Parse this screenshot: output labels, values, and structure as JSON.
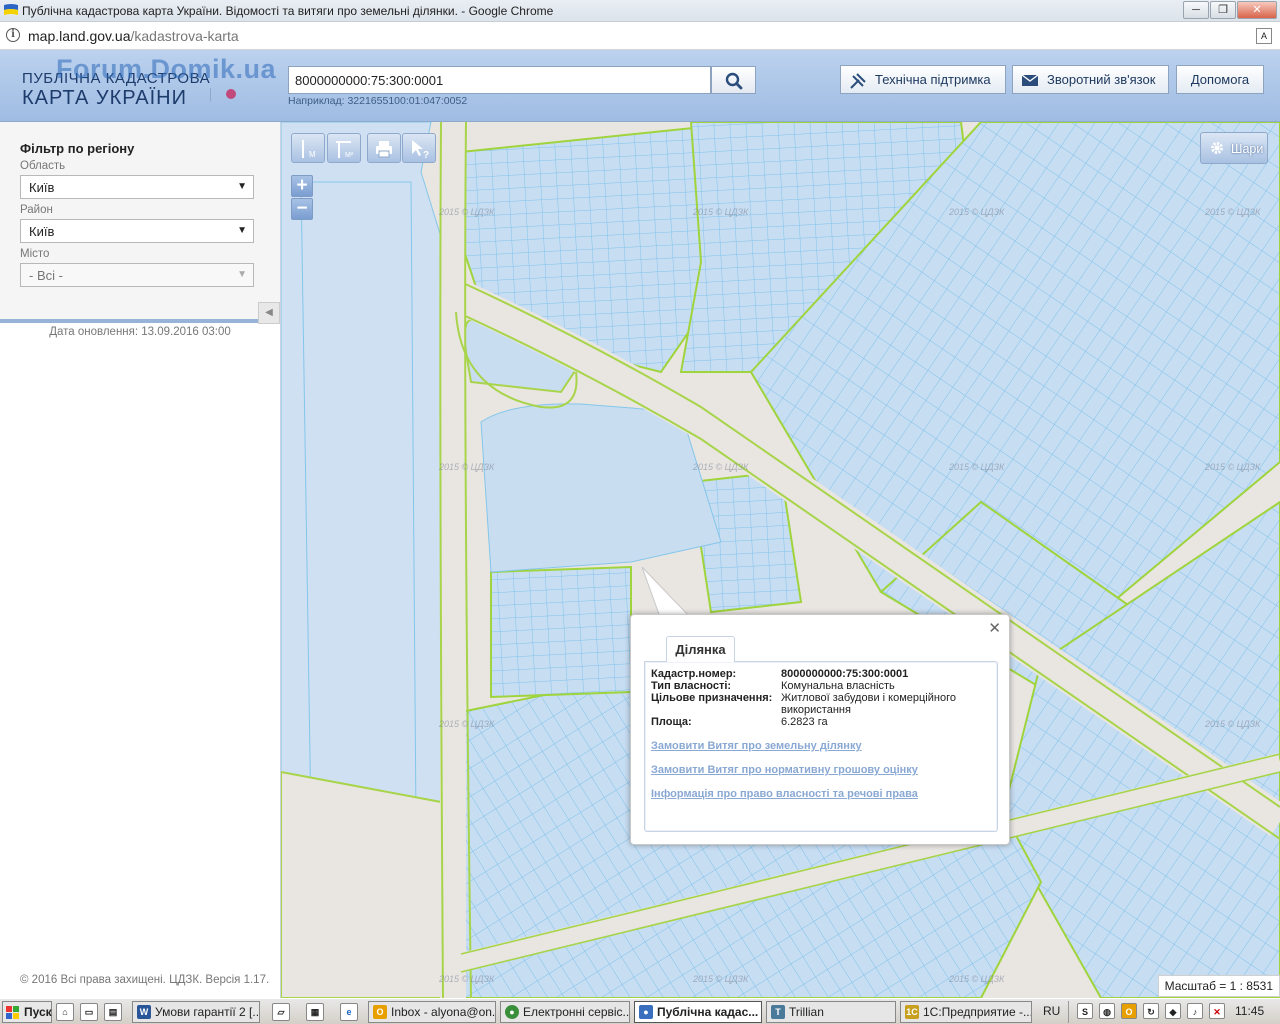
{
  "browser": {
    "window_title": "Публічна кадастрова карта України. Відомості та витяги про земельні ділянки. - Google Chrome",
    "url_domain": "map.land.gov.ua",
    "url_path": "/kadastrova-karta",
    "win_min": "─",
    "win_max": "❐",
    "win_close": "✕"
  },
  "header": {
    "watermark": "Forum.Domik.ua",
    "logo_line1": "ПУБЛІЧНА КАДАСТРОВА",
    "logo_line2": "КАРТА УКРАЇНИ",
    "search_value": "8000000000:75:300:0001",
    "search_hint": "Наприклад: 3221655100:01:047:0052",
    "btn_support": "Технічна підтримка",
    "btn_feedback": "Зворотний зв'язок",
    "btn_help": "Допомога"
  },
  "sidebar": {
    "filter_title": "Фільтр по регіону",
    "region_label": "Область",
    "region_value": "Київ",
    "district_label": "Район",
    "district_value": "Київ",
    "city_label": "Місто",
    "city_value": "- Всі -",
    "collapse_glyph": "◀",
    "updated": "Дата оновлення: 13.09.2016 03:00",
    "copyright": "© 2016 Всі права захищені. ЦДЗК. Версія 1.17."
  },
  "map": {
    "tool_measure_label": "M",
    "tool_area_label": "M²",
    "zoom_in": "+",
    "zoom_out": "−",
    "layers_label": "Шари",
    "watermark_text": "2015 © ЦДЗК",
    "scale_text": "Масштаб = 1 : 8531"
  },
  "popup": {
    "close": "✕",
    "tab_label": "Ділянка",
    "rows": [
      {
        "key": "Кадастр.номер:",
        "value": "8000000000:75:300:0001"
      },
      {
        "key": "Тип власності:",
        "value": "Комунальна власність"
      },
      {
        "key": "Цільове призначення:",
        "value": "Житлової забудови і комерційного використання"
      },
      {
        "key": "Площа:",
        "value": "6.2823 га"
      }
    ],
    "links": [
      "Замовити Витяг про земельну ділянку",
      "Замовити Витяг про нормативну грошову оцінку",
      "Інформація про право власності та речові права"
    ]
  },
  "taskbar": {
    "start_label": "Пуск",
    "tasks": [
      {
        "label": "Умови гарантії 2 [...",
        "icon": "W",
        "color": "#2a5699"
      },
      {
        "label": "Inbox - alyona@on...",
        "icon": "O",
        "color": "#e8a000"
      },
      {
        "label": "Електронні сервіс...",
        "icon": "●",
        "color": "#3a8f3a"
      },
      {
        "label": "Публічна кадас...",
        "icon": "●",
        "color": "#3a6fc0"
      },
      {
        "label": "Trillian",
        "icon": "T",
        "color": "#4a7a9a"
      },
      {
        "label": "1С:Предприятие -...",
        "icon": "1C",
        "color": "#c8a020"
      }
    ],
    "lang": "RU",
    "clock": "11:45"
  }
}
